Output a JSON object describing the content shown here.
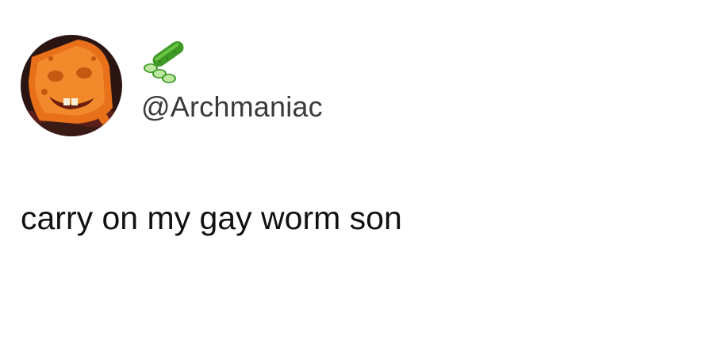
{
  "author": {
    "display_name_icon": "cucumber-emoji",
    "handle": "@Archmaniac",
    "avatar_icon": "spongebob-face"
  },
  "tweet": {
    "text": "carry on my gay worm son"
  },
  "colors": {
    "background": "#ffffff",
    "handle_text": "#3a3a3a",
    "tweet_text": "#111111",
    "avatar_sponge": "#e8701a",
    "cucumber": "#3f9a25"
  }
}
